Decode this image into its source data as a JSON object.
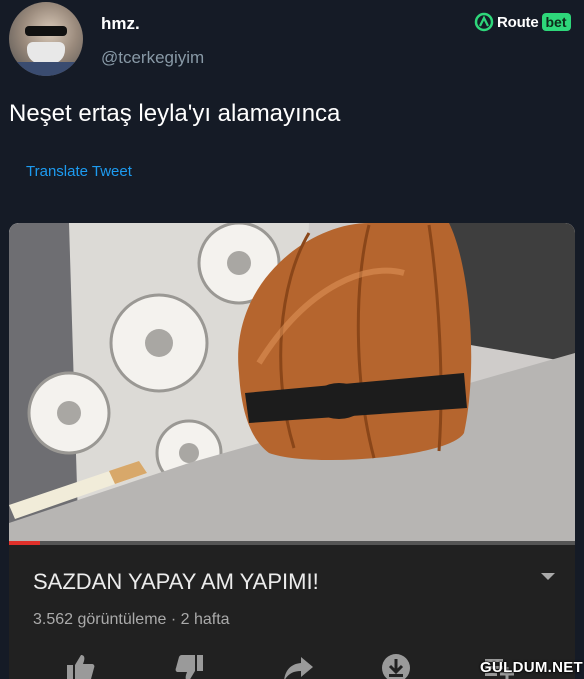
{
  "tweet": {
    "display_name": "hmz.",
    "handle": "@tcerkegiyim",
    "text": "Neşet ertaş leyla'yı alamayınca",
    "translate_label": "Translate Tweet"
  },
  "brand": {
    "word": "Route",
    "highlight": "bet",
    "accent": "#2ed77a"
  },
  "video": {
    "title": "SAZDAN YAPAY AM YAPIMI!",
    "meta": "3.562 görüntüleme · 2 hafta",
    "progress": 0.055,
    "actions": [
      "thumbs-up-icon",
      "thumbs-down-icon",
      "share-icon",
      "download-icon",
      "save-icon"
    ]
  },
  "watermark": "GULDUM.NET",
  "colors": {
    "background": "#151b26",
    "link": "#1d9bf0",
    "secondary_text": "#8899a6",
    "progress": "#e0302a"
  }
}
